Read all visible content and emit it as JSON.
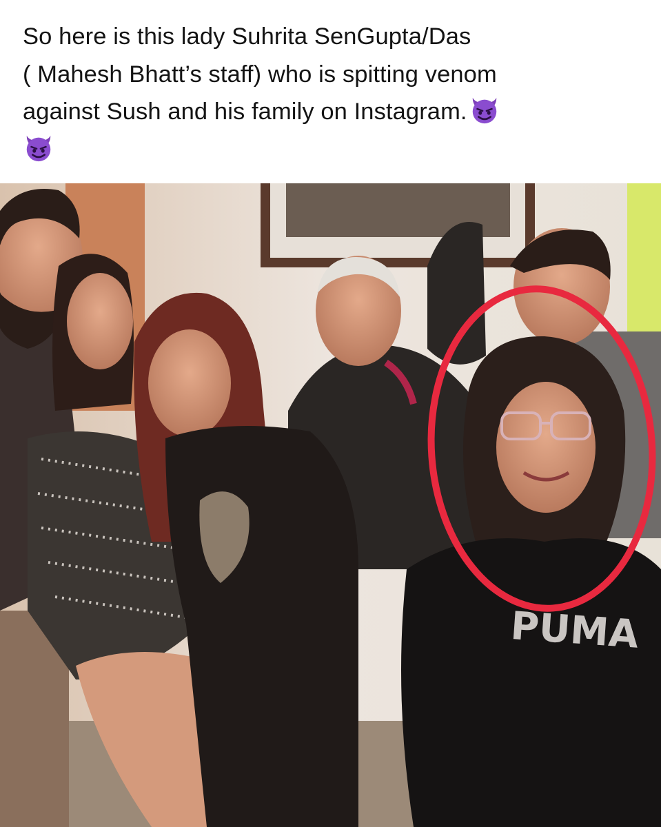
{
  "caption": {
    "lines": [
      "So here is this lady Suhrita SenGupta/Das",
      "( Mahesh Bhatt’s staff) who is spitting venom",
      "against Sush and his family on Instagram."
    ],
    "emoji": "smiling-imp-emoji"
  },
  "photo": {
    "shirt_text": "PUMA",
    "highlight_color": "#e8293f"
  }
}
